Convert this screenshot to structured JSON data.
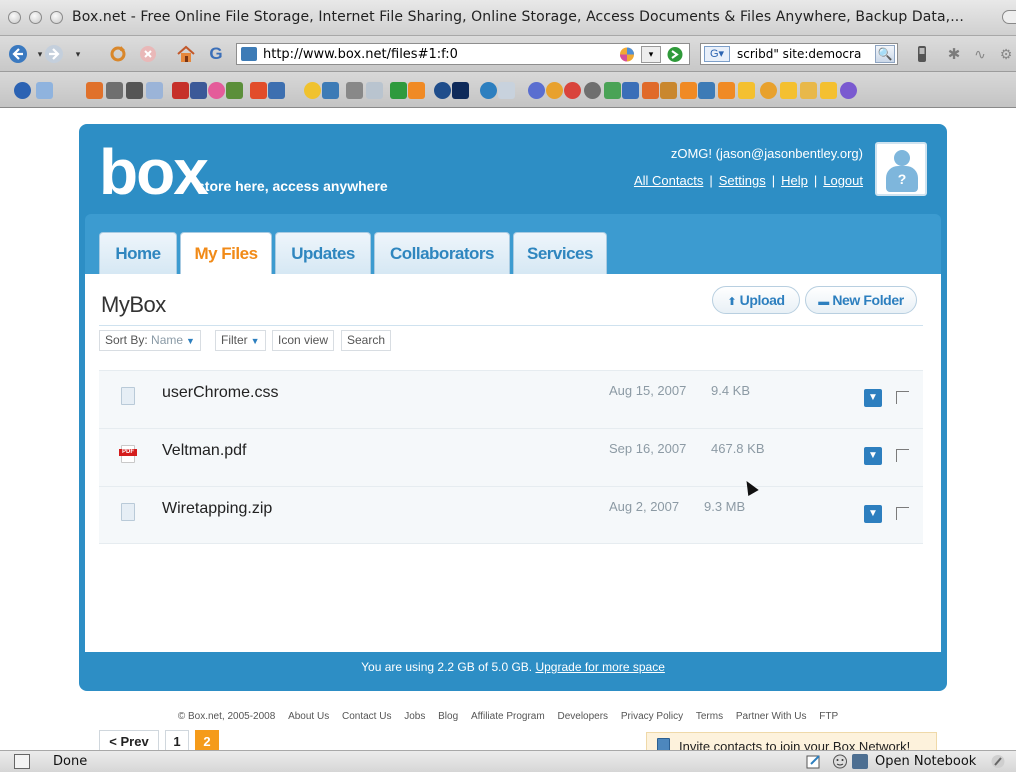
{
  "window": {
    "title": "Box.net - Free Online File Storage, Internet File Sharing, Online Storage, Access Documents & Files Anywhere, Backup Data,..."
  },
  "navbar": {
    "url": "http://www.box.net/files#1:f:0",
    "search_query": "scribd\" site:democra",
    "search_engine": "G"
  },
  "site": {
    "logo": "box",
    "tagline": "store here, access anywhere",
    "user": "zOMG! (jason@jasonbentley.org)",
    "links": [
      "All Contacts",
      "Settings",
      "Help",
      "Logout"
    ],
    "avatar_glyph": "?"
  },
  "tabs": [
    {
      "label": "Home",
      "active": false
    },
    {
      "label": "My Files",
      "active": true
    },
    {
      "label": "Updates",
      "active": false
    },
    {
      "label": "Collaborators",
      "active": false
    },
    {
      "label": "Services",
      "active": false
    }
  ],
  "main": {
    "heading": "MyBox",
    "upload_label": "Upload",
    "new_folder_label": "New Folder",
    "sort_label": "Sort By:",
    "sort_value": "Name",
    "filter_label": "Filter",
    "icon_view_label": "Icon view",
    "search_label": "Search"
  },
  "files": [
    {
      "name": "userChrome.css",
      "date": "Aug 15, 2007",
      "size": "9.4 KB",
      "type": "doc"
    },
    {
      "name": "Veltman.pdf",
      "date": "Sep 16, 2007",
      "size": "467.8 KB",
      "type": "pdf"
    },
    {
      "name": "Wiretapping.zip",
      "date": "Aug 2, 2007",
      "size": "9.3 MB",
      "type": "doc"
    }
  ],
  "pager": {
    "prev_label": "< Prev",
    "pages": [
      "1",
      "2"
    ],
    "current": "2"
  },
  "invite": {
    "text": "Invite contacts to join your Box Network!"
  },
  "usage": {
    "text": "You are using 2.2 GB of 5.0 GB.",
    "link": "Upgrade for more space"
  },
  "footer": {
    "copyright": "© Box.net, 2005-2008",
    "links": [
      "About Us",
      "Contact Us",
      "Jobs",
      "Blog",
      "Affiliate Program",
      "Developers",
      "Privacy Policy",
      "Terms",
      "Partner With Us",
      "FTP"
    ]
  },
  "status": {
    "text": "Done",
    "notebook_label": "Open Notebook"
  },
  "colors": {
    "brand_blue": "#2d8ec5",
    "accent_orange": "#f18a17"
  }
}
